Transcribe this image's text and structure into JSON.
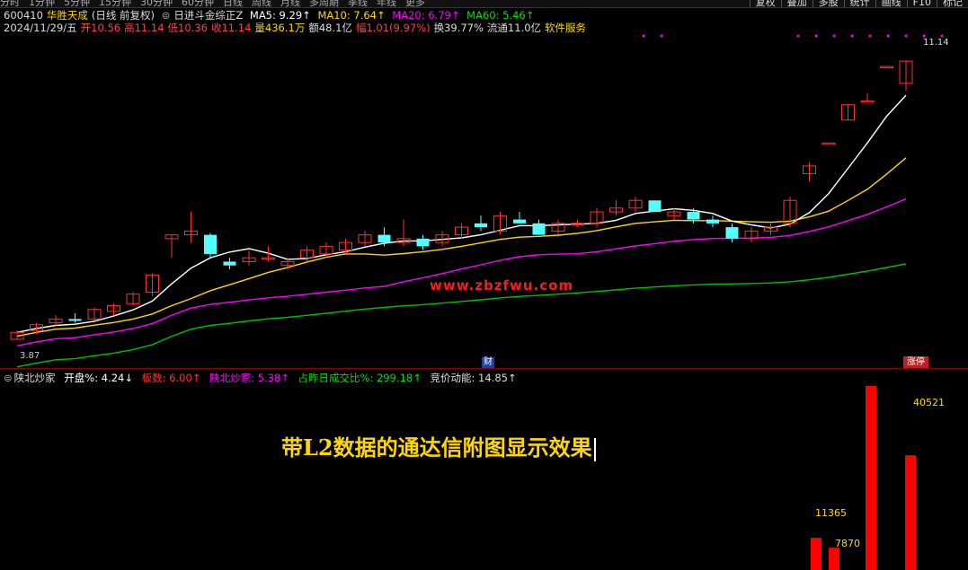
{
  "toolbar": {
    "period_tabs": [
      "分时",
      "1分钟",
      "5分钟",
      "15分钟",
      "30分钟",
      "60分钟",
      "日线",
      "周线",
      "月线",
      "多周期",
      "季线",
      "年线",
      "更多"
    ],
    "right_buttons": [
      "复权",
      "叠加",
      "多股",
      "统计",
      "画线",
      "F10",
      "标记"
    ]
  },
  "stock": {
    "code": "600410",
    "name": "华胜天成",
    "mode": "(日线 前复权)",
    "indicator_name": "日进斗金综正Z",
    "ma5": "MA5: 9.29↑",
    "ma10": "MA10: 7.64↑",
    "ma20": "MA20: 6.79↑",
    "ma60": "MA60: 5.46↑"
  },
  "quote": {
    "date": "2024/11/29/五",
    "open": "开10.56",
    "high": "高11.14",
    "low": "低10.36",
    "close": "收11.14",
    "volume": "量436.1万",
    "amount": "额48.1亿",
    "change": "幅1.01(9.97%)",
    "turnover": "换39.77%",
    "float": "流通11.0亿",
    "sector": "软件服务"
  },
  "chart_labels": {
    "low_price": "3.87",
    "high_price": "11.14",
    "cai_badge": "财",
    "limit_up_badge": "涨停",
    "watermark": "www.zbzfwu.com"
  },
  "sub_indicator": {
    "name": "陕北炒家",
    "open_pct": "开盘%: 4.24↓",
    "board": "板数: 6.00↑",
    "shanbei": "陕北炒家: 5.38↑",
    "ratio": "占昨日成交比%: 299.18↑",
    "auction": "竞价动能: 14.85↑"
  },
  "caption": "带L2数据的通达信附图显示效果",
  "volume_labels": [
    "11365",
    "7870",
    "40521"
  ],
  "colors": {
    "up": "#ff3030",
    "down": "#54ffff",
    "ma5": "#ffffff",
    "ma10": "#ffd700",
    "ma20": "#ff00ff",
    "ma60": "#00c000",
    "bar": "#ff0000"
  },
  "chart_data": {
    "type": "candlestick",
    "candles": [
      {
        "o": 3.87,
        "h": 4.1,
        "l": 3.87,
        "c": 4.05
      },
      {
        "o": 4.1,
        "h": 4.3,
        "l": 4.0,
        "c": 4.25
      },
      {
        "o": 4.3,
        "h": 4.5,
        "l": 4.2,
        "c": 4.4
      },
      {
        "o": 4.4,
        "h": 4.55,
        "l": 4.3,
        "c": 4.35
      },
      {
        "o": 4.4,
        "h": 4.7,
        "l": 4.35,
        "c": 4.65
      },
      {
        "o": 4.6,
        "h": 4.8,
        "l": 4.5,
        "c": 4.75
      },
      {
        "o": 4.8,
        "h": 5.1,
        "l": 4.75,
        "c": 5.05
      },
      {
        "o": 5.1,
        "h": 5.6,
        "l": 5.0,
        "c": 5.55
      },
      {
        "o": 6.5,
        "h": 6.6,
        "l": 6.0,
        "c": 6.6
      },
      {
        "o": 6.6,
        "h": 7.2,
        "l": 6.4,
        "c": 6.7
      },
      {
        "o": 6.6,
        "h": 6.65,
        "l": 6.0,
        "c": 6.1
      },
      {
        "o": 5.9,
        "h": 6.0,
        "l": 5.7,
        "c": 5.8
      },
      {
        "o": 5.9,
        "h": 6.2,
        "l": 5.8,
        "c": 6.0
      },
      {
        "o": 6.0,
        "h": 6.3,
        "l": 5.9,
        "c": 6.0
      },
      {
        "o": 5.8,
        "h": 6.0,
        "l": 5.7,
        "c": 5.9
      },
      {
        "o": 6.0,
        "h": 6.3,
        "l": 5.9,
        "c": 6.2
      },
      {
        "o": 6.1,
        "h": 6.4,
        "l": 6.0,
        "c": 6.3
      },
      {
        "o": 6.2,
        "h": 6.5,
        "l": 6.1,
        "c": 6.4
      },
      {
        "o": 6.4,
        "h": 6.7,
        "l": 6.3,
        "c": 6.6
      },
      {
        "o": 6.6,
        "h": 6.8,
        "l": 6.3,
        "c": 6.4
      },
      {
        "o": 6.4,
        "h": 7.0,
        "l": 6.3,
        "c": 6.5
      },
      {
        "o": 6.5,
        "h": 6.6,
        "l": 6.2,
        "c": 6.3
      },
      {
        "o": 6.4,
        "h": 6.7,
        "l": 6.3,
        "c": 6.6
      },
      {
        "o": 6.6,
        "h": 6.9,
        "l": 6.5,
        "c": 6.8
      },
      {
        "o": 6.9,
        "h": 7.1,
        "l": 6.7,
        "c": 6.8
      },
      {
        "o": 6.7,
        "h": 7.2,
        "l": 6.6,
        "c": 7.1
      },
      {
        "o": 7.0,
        "h": 7.2,
        "l": 6.9,
        "c": 6.9
      },
      {
        "o": 6.9,
        "h": 7.0,
        "l": 6.6,
        "c": 6.6
      },
      {
        "o": 6.7,
        "h": 7.0,
        "l": 6.6,
        "c": 6.9
      },
      {
        "o": 6.9,
        "h": 7.0,
        "l": 6.8,
        "c": 6.9
      },
      {
        "o": 6.9,
        "h": 7.3,
        "l": 6.8,
        "c": 7.2
      },
      {
        "o": 7.2,
        "h": 7.5,
        "l": 7.1,
        "c": 7.3
      },
      {
        "o": 7.3,
        "h": 7.6,
        "l": 7.2,
        "c": 7.5
      },
      {
        "o": 7.5,
        "h": 7.5,
        "l": 7.2,
        "c": 7.2
      },
      {
        "o": 7.1,
        "h": 7.3,
        "l": 7.0,
        "c": 7.2
      },
      {
        "o": 7.2,
        "h": 7.3,
        "l": 6.9,
        "c": 7.0
      },
      {
        "o": 7.0,
        "h": 7.1,
        "l": 6.8,
        "c": 6.9
      },
      {
        "o": 6.8,
        "h": 6.9,
        "l": 6.4,
        "c": 6.5
      },
      {
        "o": 6.5,
        "h": 6.8,
        "l": 6.4,
        "c": 6.7
      },
      {
        "o": 6.7,
        "h": 6.9,
        "l": 6.6,
        "c": 6.8
      },
      {
        "o": 6.9,
        "h": 7.6,
        "l": 6.8,
        "c": 7.5
      },
      {
        "o": 8.2,
        "h": 8.5,
        "l": 8.0,
        "c": 8.4
      },
      {
        "o": 9.0,
        "h": 9.0,
        "l": 9.0,
        "c": 9.0
      },
      {
        "o": 9.6,
        "h": 10.0,
        "l": 9.6,
        "c": 10.0
      },
      {
        "o": 10.1,
        "h": 10.3,
        "l": 10.1,
        "c": 10.1
      },
      {
        "o": 11.0,
        "h": 11.0,
        "l": 11.0,
        "c": 11.0
      },
      {
        "o": 10.56,
        "h": 11.14,
        "l": 10.36,
        "c": 11.14
      }
    ],
    "volume_bars": [
      11365,
      7870,
      65000,
      40521
    ]
  }
}
